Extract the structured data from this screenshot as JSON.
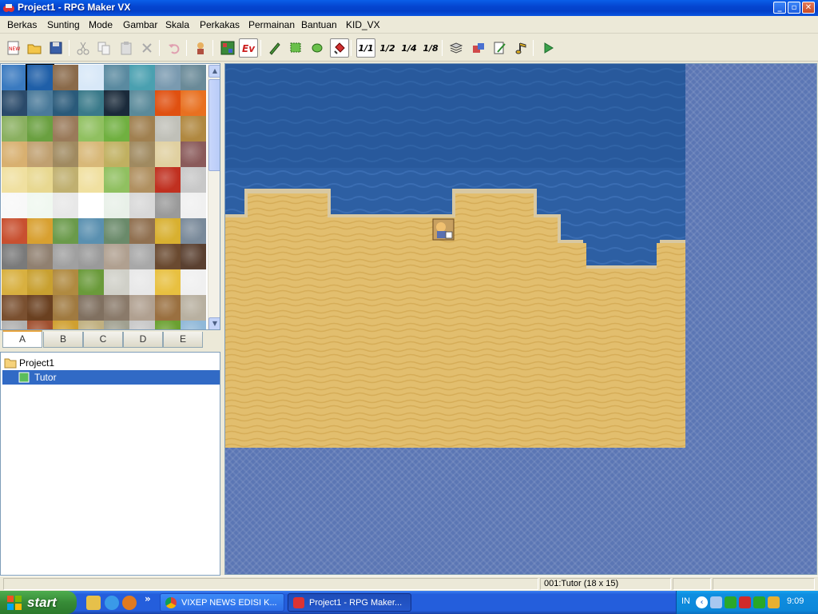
{
  "window": {
    "title": "Project1 - RPG Maker VX",
    "controls": [
      "minimize",
      "maximize",
      "close"
    ]
  },
  "menu": {
    "items": [
      "Berkas",
      "Sunting",
      "Mode",
      "Gambar",
      "Skala",
      "Perkakas",
      "Permainan",
      "Bantuan",
      "KID_VX"
    ]
  },
  "toolbar": {
    "buttons": [
      "new",
      "open",
      "save",
      "cut",
      "copy",
      "paste",
      "delete",
      "undo",
      "character",
      "map-layer",
      "event-layer",
      "pencil",
      "rectangle",
      "ellipse",
      "flood-fill",
      "scale-1-1",
      "scale-1-2",
      "scale-1-4",
      "scale-1-8",
      "database",
      "resource-manager",
      "script-editor",
      "sound-test",
      "playtest"
    ],
    "scale_labels": [
      "1/1",
      "1/2",
      "1/4",
      "1/8"
    ],
    "new_label": "NEW",
    "event_label": "Ev",
    "pressed": [
      "event-layer",
      "flood-fill",
      "scale-1-1"
    ]
  },
  "tileset": {
    "tabs": [
      "A",
      "B",
      "C",
      "D",
      "E"
    ],
    "active_tab": "A"
  },
  "map_tree": {
    "items": [
      {
        "label": "Project1",
        "type": "project"
      },
      {
        "label": "Tutor",
        "type": "map",
        "selected": true
      }
    ]
  },
  "map": {
    "name": "Tutor",
    "width_tiles": 18,
    "height_tiles": 15
  },
  "statusbar": {
    "map_info": "001:Tutor (18 x 15)"
  },
  "taskbar": {
    "start_label": "start",
    "overflow_label": "»",
    "tasks": [
      {
        "label": "VIXEP NEWS EDISI K...",
        "active": false
      },
      {
        "label": "Project1 - RPG Maker...",
        "active": true
      }
    ],
    "language": "IN",
    "clock": "9:09"
  },
  "colors": {
    "water": "#2d5fa3",
    "sand": "#e2be6e",
    "void": "#5b76b4",
    "selection": "#316ac5"
  }
}
